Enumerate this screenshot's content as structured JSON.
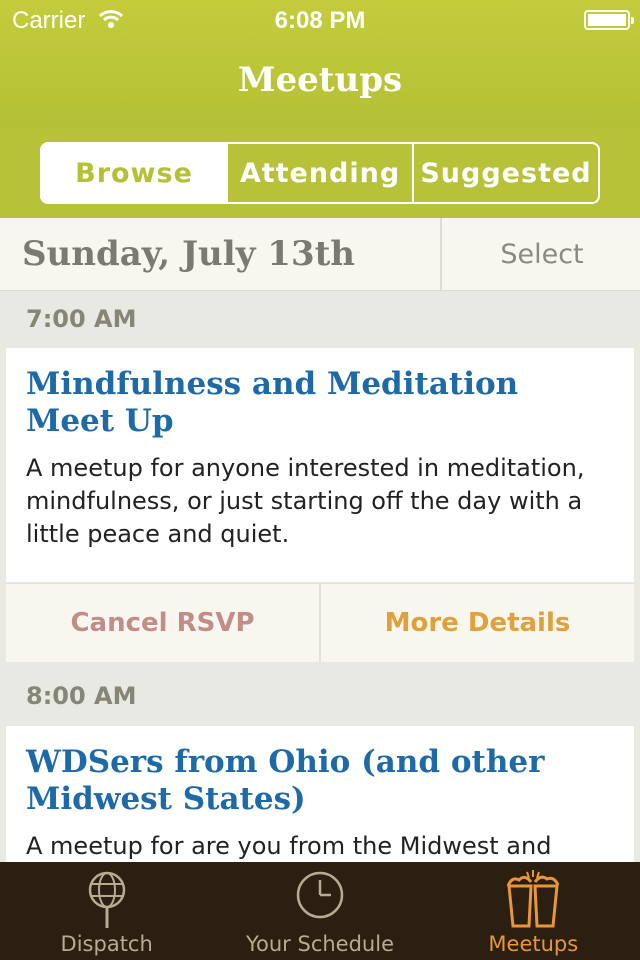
{
  "status": {
    "carrier": "Carrier",
    "time": "6:08 PM"
  },
  "nav": {
    "title": "Meetups"
  },
  "segments": [
    {
      "label": "Browse",
      "active": true
    },
    {
      "label": "Attending",
      "active": false
    },
    {
      "label": "Suggested",
      "active": false
    }
  ],
  "day": {
    "date": "Sunday, July 13th",
    "select_label": "Select"
  },
  "meetups": [
    {
      "time": "7:00 AM",
      "title": "Mindfulness and Meditation Meet Up",
      "description": "A meetup for anyone interested in meditation, mindfulness, or just starting off the day with a little peace and quiet.",
      "cancel_label": "Cancel RSVP",
      "details_label": "More Details"
    },
    {
      "time": "8:00 AM",
      "title": "WDSers from Ohio (and other Midwest States)",
      "description": "A meetup for are you from the Midwest and"
    }
  ],
  "tabs": [
    {
      "label": "Dispatch",
      "icon": "globe-pin-icon",
      "active": false
    },
    {
      "label": "Your Schedule",
      "icon": "clock-icon",
      "active": false
    },
    {
      "label": "Meetups",
      "icon": "drinks-icon",
      "active": true
    }
  ],
  "colors": {
    "accent": "#b4c035",
    "title_blue": "#1e6aa8",
    "details_orange": "#e0a03c",
    "cancel_rose": "#c28c88",
    "tabbar": "#2b1f12"
  }
}
